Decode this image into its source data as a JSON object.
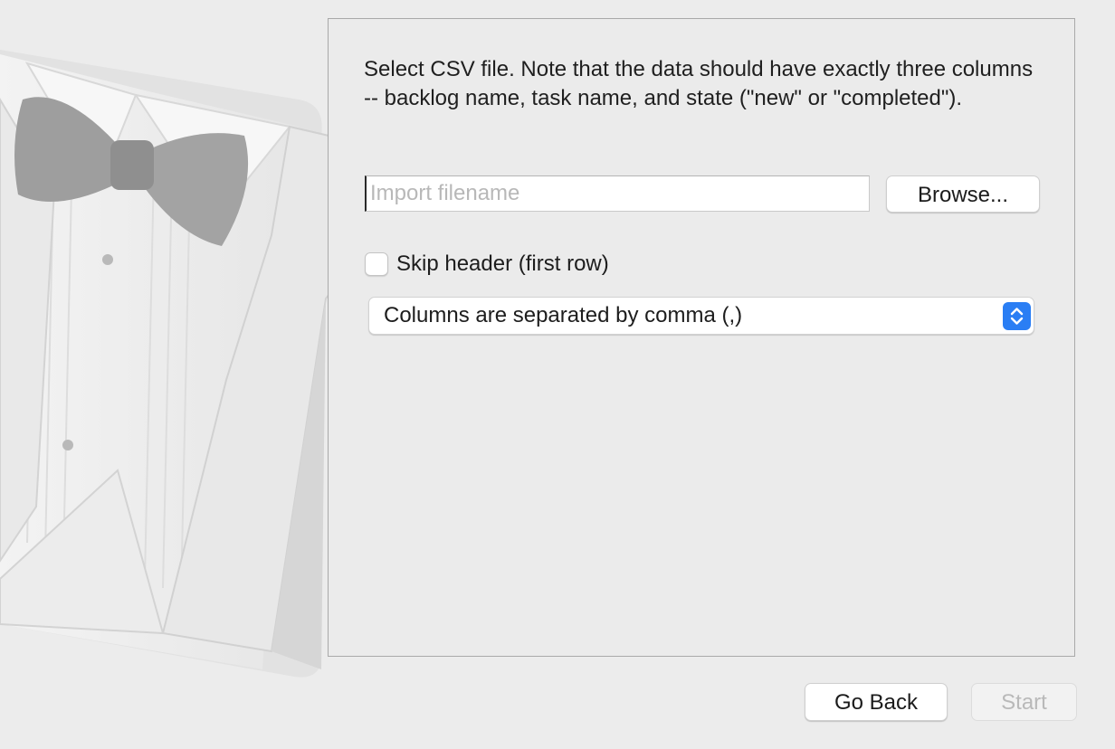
{
  "instructions": "Select CSV file. Note that the data should have exactly three columns -- backlog name, task name, and state (\"new\" or \"completed\").",
  "file_input": {
    "value": "",
    "placeholder": "Import filename"
  },
  "browse_label": "Browse...",
  "skip_header": {
    "label": "Skip header (first row)",
    "checked": false
  },
  "separator_select": {
    "selected": "Columns are separated by comma (,)"
  },
  "footer": {
    "go_back_label": "Go Back",
    "start_label": "Start",
    "start_enabled": false
  },
  "colors": {
    "accent": "#2a7ef4",
    "background": "#ececec",
    "panel_border": "#a9a9a9"
  },
  "icons": {
    "illustration": "tuxedo-illustration",
    "select_arrows": "chevron-updown-icon"
  }
}
